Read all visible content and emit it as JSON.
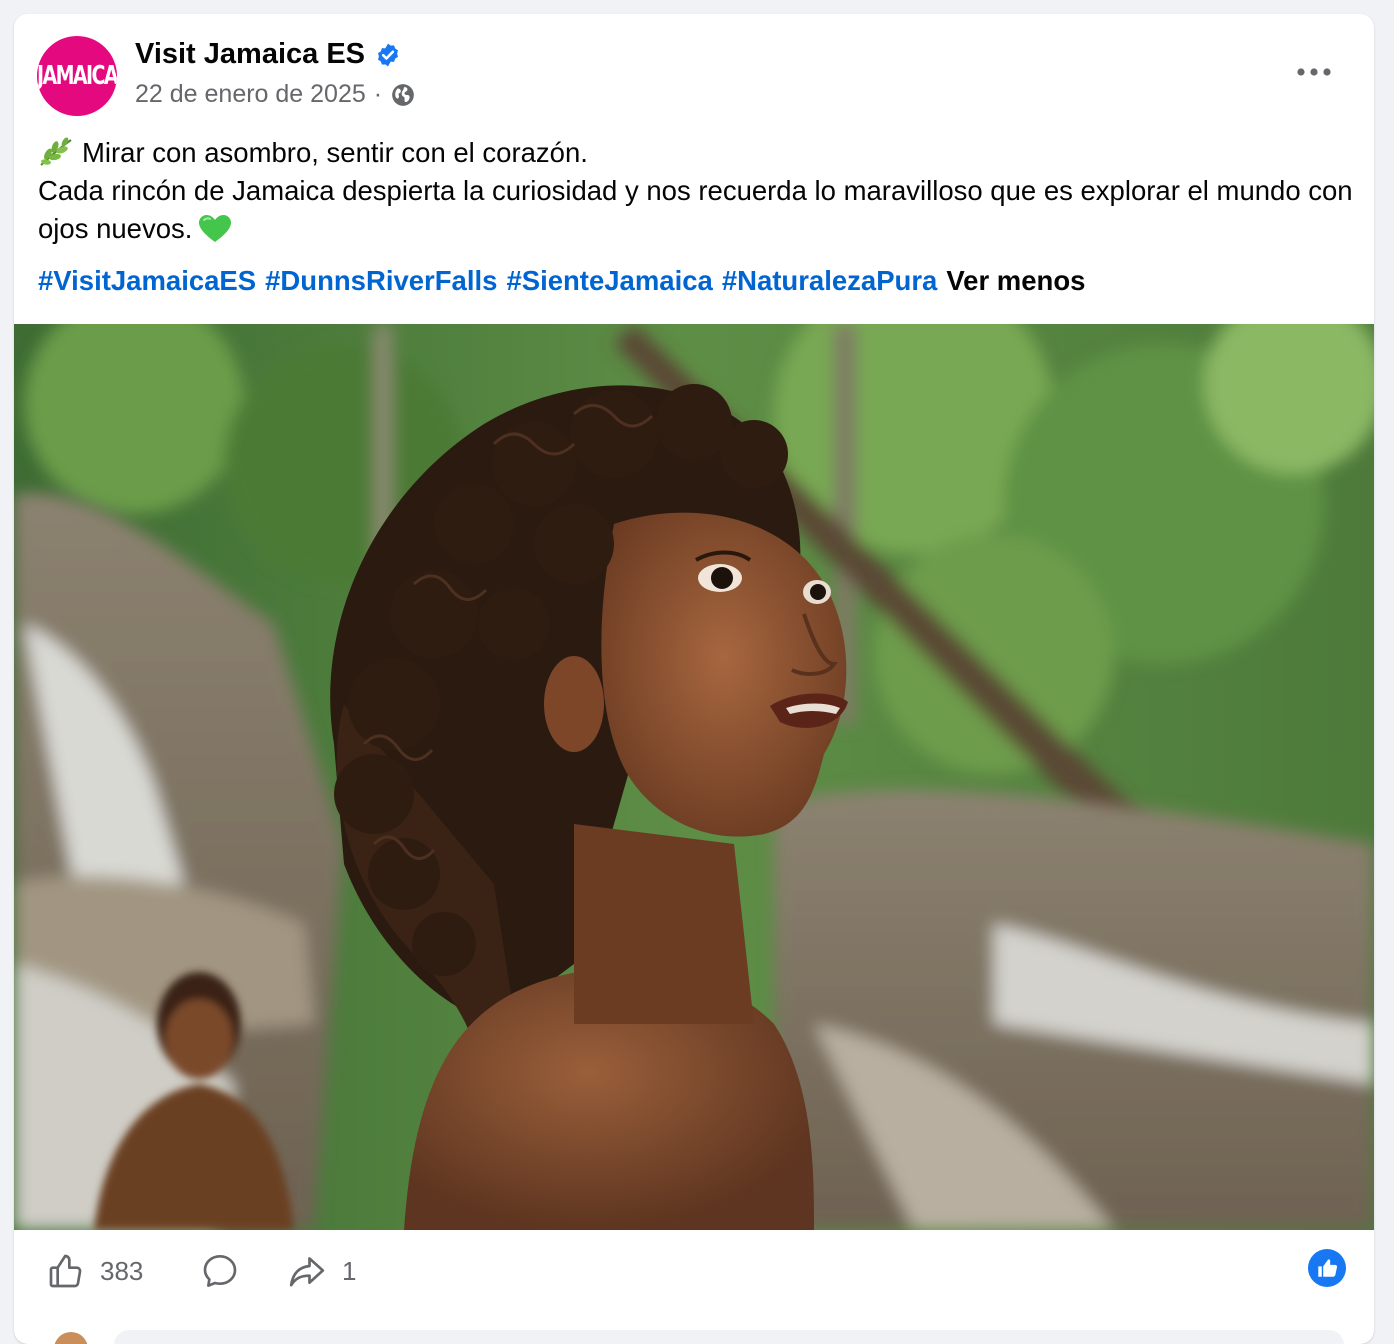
{
  "post": {
    "page_name": "Visit Jamaica ES",
    "avatar_text": "JAMAICA",
    "date": "22 de enero de 2025",
    "separator": "·",
    "line1": "Mirar con asombro, sentir con el corazón.",
    "line2": "Cada rincón de Jamaica despierta la curiosidad y nos recuerda lo maravilloso que es explorar el mundo con ojos nuevos.",
    "hashtags": [
      "#VisitJamaicaES",
      "#DunnsRiverFalls",
      "#SienteJamaica",
      "#NaturalezaPura"
    ],
    "see_less": "Ver menos"
  },
  "stats": {
    "likes": "383",
    "shares": "1"
  },
  "icons": {
    "verified": "verified-badge-icon",
    "audience": "globe-icon",
    "more": "more-options-icon",
    "leaf": "herb-emoji",
    "heart": "green-heart-emoji",
    "like": "thumbs-up-icon",
    "comment": "comment-bubble-icon",
    "share": "share-arrow-icon",
    "reaction": "like-reaction-badge"
  },
  "colors": {
    "brand_pink": "#e5097f",
    "link_blue": "#0064d1",
    "meta_gray": "#65676b",
    "verified_blue": "#1877f2"
  }
}
